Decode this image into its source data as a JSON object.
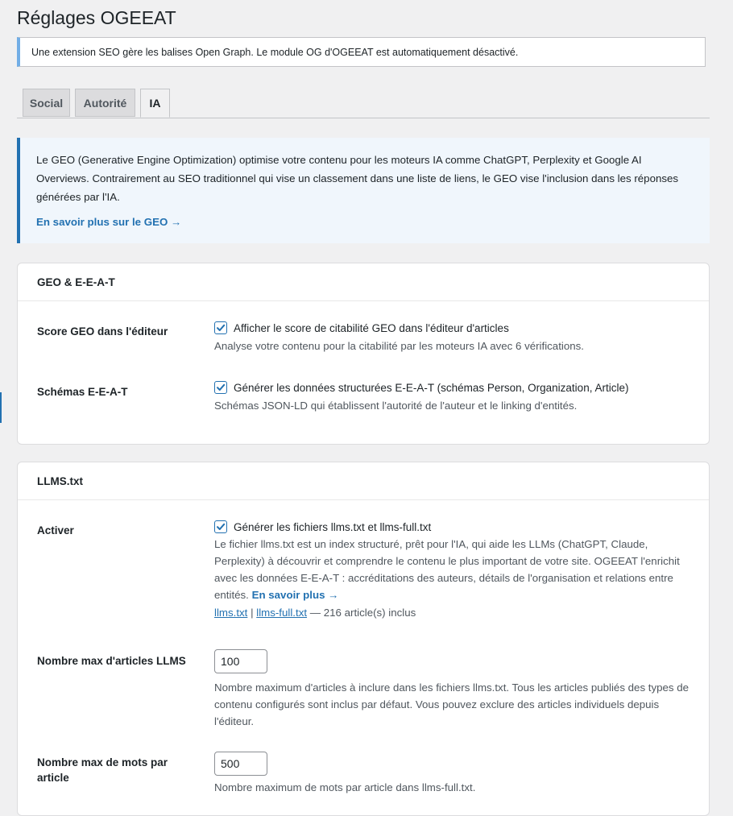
{
  "page": {
    "title": "Réglages OGEEAT"
  },
  "notice": {
    "text": "Une extension SEO gère les balises Open Graph. Le module OG d'OGEEAT est automatiquement désactivé."
  },
  "tabs": [
    {
      "label": "Social"
    },
    {
      "label": "Autorité"
    },
    {
      "label": "IA",
      "active": true
    }
  ],
  "info_box": {
    "text": "Le GEO (Generative Engine Optimization) optimise votre contenu pour les moteurs IA comme ChatGPT, Perplexity et Google AI Overviews. Contrairement au SEO traditionnel qui vise un classement dans une liste de liens, le GEO vise l'inclusion dans les réponses générées par l'IA.",
    "link": "En savoir plus sur le GEO →"
  },
  "geo_section": {
    "title": "GEO & E-E-A-T",
    "score": {
      "label": "Score GEO dans l'éditeur",
      "checkbox_label": "Afficher le score de citabilité GEO dans l'éditeur d'articles",
      "checked": true,
      "description": "Analyse votre contenu pour la citabilité par les moteurs IA avec 6 vérifications."
    },
    "schemas": {
      "label": "Schémas E-E-A-T",
      "checkbox_label": "Générer les données structurées E-E-A-T (schémas Person, Organization, Article)",
      "checked": true,
      "description": "Schémas JSON-LD qui établissent l'autorité de l'auteur et le linking d'entités."
    }
  },
  "llms_section": {
    "title": "LLMS.txt",
    "activate": {
      "label": "Activer",
      "checkbox_label": "Générer les fichiers llms.txt et llms-full.txt",
      "checked": true,
      "description": "Le fichier llms.txt est un index structuré, prêt pour l'IA, qui aide les LLMs (ChatGPT, Claude, Perplexity) à découvrir et comprendre le contenu le plus important de votre site. OGEEAT l'enrichit avec les données E-E-A-T : accréditations des auteurs, détails de l'organisation et relations entre entités.",
      "more_link": "En savoir plus →",
      "file_link_1": "llms.txt",
      "separator": "|",
      "file_link_2": "llms-full.txt",
      "count_text": "— 216 article(s) inclus"
    },
    "max_articles": {
      "label": "Nombre max d'articles LLMS",
      "value": "100",
      "description": "Nombre maximum d'articles à inclure dans les fichiers llms.txt. Tous les articles publiés des types de contenu configurés sont inclus par défaut. Vous pouvez exclure des articles individuels depuis l'éditeur."
    },
    "max_words": {
      "label": "Nombre max de mots par article",
      "value": "500",
      "description": "Nombre maximum de mots par article dans llms-full.txt."
    }
  },
  "colors": {
    "accent": "#2271b1",
    "notice_border": "#72aee6",
    "info_bg": "#f0f6fc"
  }
}
